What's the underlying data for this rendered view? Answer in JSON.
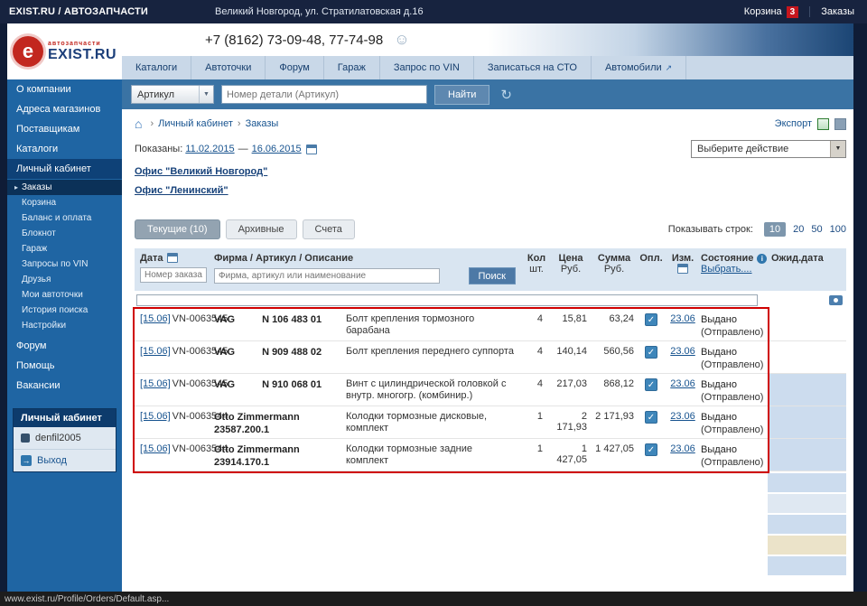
{
  "glyphs": {
    "home": "⌂",
    "crumb_sep": "›",
    "dropdown_arrow": "▼",
    "history": "↻",
    "external": "↗",
    "smiley": "☺",
    "check": "✓",
    "info": "i",
    "submenu_marker": "▸",
    "logout_arrow": "→",
    "gear": "e"
  },
  "colors": {
    "topbar": "#17233f",
    "sidebar": "#1f65a3",
    "search_bar": "#3a73a4",
    "nav_bg": "#c9d8e8",
    "table_header": "#d9e5f1",
    "highlight_border": "#cf0000",
    "wait_cell_blue": "#ccdcee",
    "wait_cell_beige": "#ebe3c9",
    "cart_badge": "#c6161d"
  },
  "topbar": {
    "brand": "EXIST.RU / АВТОЗАПЧАСТИ",
    "address": "Великий Новгород, ул. Стратилатовская д.16",
    "cart": "Корзина",
    "cart_count": "3",
    "orders": "Заказы"
  },
  "logo": {
    "sub": "автозапчасти",
    "text": "EXIST.RU"
  },
  "header": {
    "phone": "+7 (8162) 73-09-48, 77-74-98"
  },
  "nav": {
    "i0": "Каталоги",
    "i1": "Автоточки",
    "i2": "Форум",
    "i3": "Гараж",
    "i4": "Запрос по VIN",
    "i5": "Записаться на СТО",
    "i6": "Автомобили"
  },
  "search": {
    "category": "Артикул",
    "placeholder": "Номер детали (Артикул)",
    "button": "Найти"
  },
  "sidebar": {
    "items": [
      "О компании",
      "Адреса магазинов",
      "Поставщикам",
      "Каталоги",
      "Личный кабинет"
    ],
    "sub": [
      "Заказы",
      "Корзина",
      "Баланс и оплата",
      "Блокнот",
      "Гараж",
      "Запросы по VIN",
      "Друзья",
      "Мои автоточки",
      "История поиска",
      "Настройки"
    ],
    "tail": [
      "Форум",
      "Помощь",
      "Вакансии"
    ],
    "account": {
      "title": "Личный кабинет",
      "user": "denfil2005",
      "logout": "Выход"
    }
  },
  "breadcrumb": {
    "items": [
      "Личный кабинет",
      "Заказы"
    ],
    "export": "Экспорт"
  },
  "period": {
    "label": "Показаны:",
    "from": "11.02.2015",
    "dash": "—",
    "to": "16.06.2015"
  },
  "action_select": {
    "value": "Выберите действие"
  },
  "offices": [
    "Офис \"Великий Новгород\"",
    "Офис \"Ленинский\""
  ],
  "tabs": {
    "current": "Текущие (10)",
    "archive": "Архивные",
    "bills": "Счета"
  },
  "page_size": {
    "label": "Показывать строк:",
    "options": [
      "10",
      "20",
      "50",
      "100"
    ],
    "active": "10"
  },
  "table": {
    "headers": {
      "date": "Дата",
      "firm": "Фирма / Артикул / Описание",
      "qty1": "Кол",
      "qty2": "шт.",
      "price1": "Цена",
      "price2": "Руб.",
      "sum1": "Сумма",
      "sum2": "Руб.",
      "paid": "Опл.",
      "changed": "Изм.",
      "status": "Состояние",
      "select": "Выбрать....",
      "wait": "Ожид.дата"
    },
    "filter": {
      "order_placeholder": "Номер заказа",
      "firm_placeholder": "Фирма, артикул или наименование",
      "search": "Поиск"
    },
    "rows": [
      {
        "date": "[15.06]",
        "order": "VN-0063545",
        "brand": "VAG",
        "article": "N 106 483 01",
        "desc": "Болт крепления тормозного барабана",
        "qty": "4",
        "price": "15,81",
        "sum": "63,24",
        "paid": "✓",
        "changed": "23.06",
        "status": "Выдано",
        "note": "(Отправлено)"
      },
      {
        "date": "[15.06]",
        "order": "VN-0063545",
        "brand": "VAG",
        "article": "N 909 488 02",
        "desc": "Болт крепления переднего суппорта",
        "qty": "4",
        "price": "140,14",
        "sum": "560,56",
        "paid": "✓",
        "changed": "23.06",
        "status": "Выдано",
        "note": "(Отправлено)"
      },
      {
        "date": "[15.06]",
        "order": "VN-0063545",
        "brand": "VAG",
        "article": "N 910 068 01",
        "desc": "Винт с цилиндрической головкой с внутр. многогр. (комбинир.)",
        "qty": "4",
        "price": "217,03",
        "sum": "868,12",
        "paid": "✓",
        "changed": "23.06",
        "status": "Выдано",
        "note": "(Отправлено)"
      },
      {
        "date": "[15.06]",
        "order": "VN-0063544",
        "brand": "Otto Zimmermann",
        "article": "23587.200.1",
        "desc": "Колодки тормозные дисковые, комплект",
        "qty": "1",
        "price": "2 171,93",
        "sum": "2 171,93",
        "paid": "✓",
        "changed": "23.06",
        "status": "Выдано",
        "note": "(Отправлено)"
      },
      {
        "date": "[15.06]",
        "order": "VN-0063544",
        "brand": "Otto Zimmermann",
        "article": "23914.170.1",
        "desc": "Колодки тормозные задние комплект",
        "qty": "1",
        "price": "1 427,05",
        "sum": "1 427,05",
        "paid": "✓",
        "changed": "23.06",
        "status": "Выдано",
        "note": "(Отправлено)"
      }
    ]
  },
  "statusbar": {
    "url": "www.exist.ru/Profile/Orders/Default.asp..."
  }
}
